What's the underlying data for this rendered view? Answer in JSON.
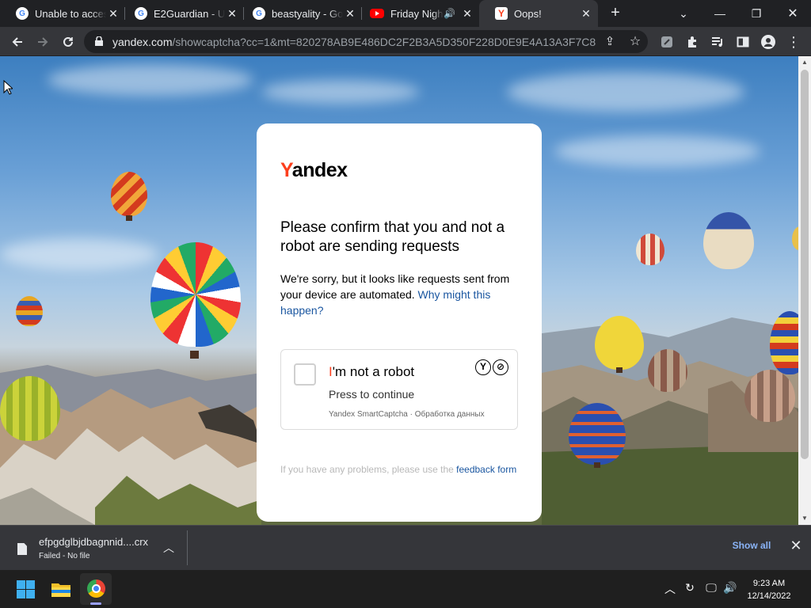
{
  "tabs": [
    {
      "title": "Unable to access",
      "favicon": "google-icon"
    },
    {
      "title": "E2Guardian - Ur",
      "favicon": "google-icon"
    },
    {
      "title": "beastyality - Go",
      "favicon": "google-icon"
    },
    {
      "title": "Friday Nigh",
      "favicon": "youtube-icon",
      "audio": true
    },
    {
      "title": "Oops!",
      "favicon": "yandex-icon",
      "active": true
    }
  ],
  "toolbar": {
    "url_domain": "yandex.com",
    "url_rest": "/showcaptcha?cc=1&mt=820278AB9E486DC2F2B3A5D350F228D0E9E4A13A3F7C86..."
  },
  "captcha": {
    "logo_first": "Y",
    "logo_rest": "andex",
    "heading": "Please confirm that you and not a robot are sending requests",
    "body": "We're sorry, but it looks like requests sent from your device are automated.",
    "why_link": "Why might this happen?",
    "robot_first": "I",
    "robot_rest": "'m not a robot",
    "press": "Press to continue",
    "smart": "Yandex SmartCaptcha · Обработка данных",
    "feedback_text": "If you have any problems, please use the",
    "feedback_link": "feedback form"
  },
  "download": {
    "file_name": "efpgdglbjdbagnnid....crx",
    "status": "Failed - No file",
    "show_all": "Show all"
  },
  "taskbar": {
    "time": "9:23 AM",
    "date": "12/14/2022"
  },
  "colors": {
    "yandex_red": "#fc3f1d",
    "link_blue": "#1a56a0",
    "show_all": "#8ab4f8"
  }
}
